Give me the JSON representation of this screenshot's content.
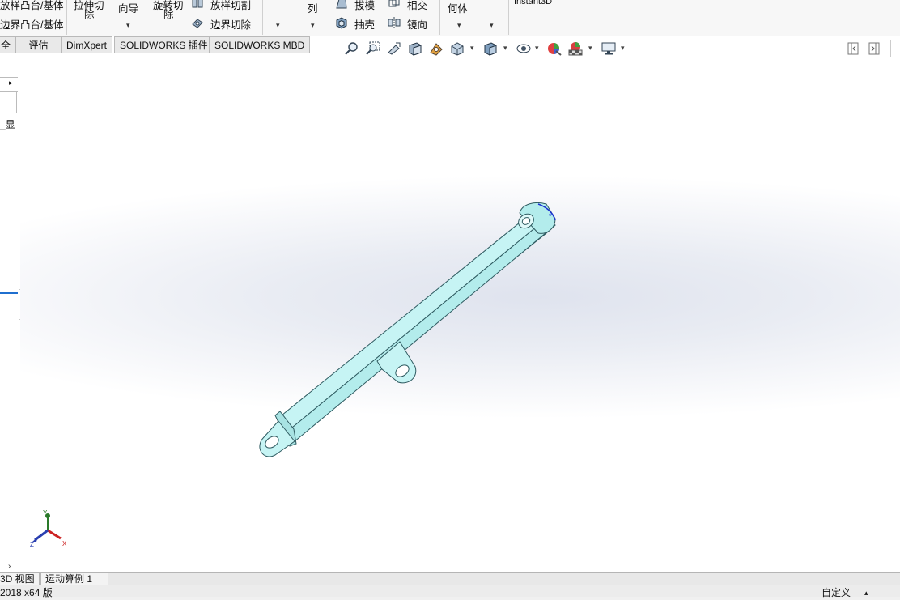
{
  "ribbon": {
    "loft_boss": "放样凸台/基体",
    "boundary_boss": "边界凸台/基体",
    "extrude_cut_1": "拉伸切",
    "extrude_cut_2": "除",
    "sweep_1": "向导",
    "revolve_cut_1": "旋转切",
    "revolve_cut_2": "除",
    "loft_cut": "放样切割",
    "boundary_cut": "边界切除",
    "pattern": "列",
    "draft": "拔模",
    "shell": "抽壳",
    "intersect": "相交",
    "mirror": "镜向",
    "geometry": "何体",
    "instant3d": "Instant3D"
  },
  "tabs": [
    {
      "label": "全"
    },
    {
      "label": "评估"
    },
    {
      "label": "DimXpert"
    },
    {
      "label": "SOLIDWORKS 插件"
    },
    {
      "label": "SOLIDWORKS MBD"
    }
  ],
  "left_panel": {
    "display_label": "_显"
  },
  "bottom_tabs": [
    {
      "label": "3D 视图"
    },
    {
      "label": "运动算例 1"
    }
  ],
  "status": {
    "version_text": "2018 x64 版",
    "custom_text": "自定义"
  },
  "axes": {
    "x": "X",
    "y": "Y",
    "z": "Z"
  },
  "colors": {
    "part_face": "#bff2f2",
    "part_edge": "#2e5a60",
    "axis_x": "#cc2222",
    "axis_y": "#2a7a2a",
    "axis_z": "#2a3fb0"
  }
}
